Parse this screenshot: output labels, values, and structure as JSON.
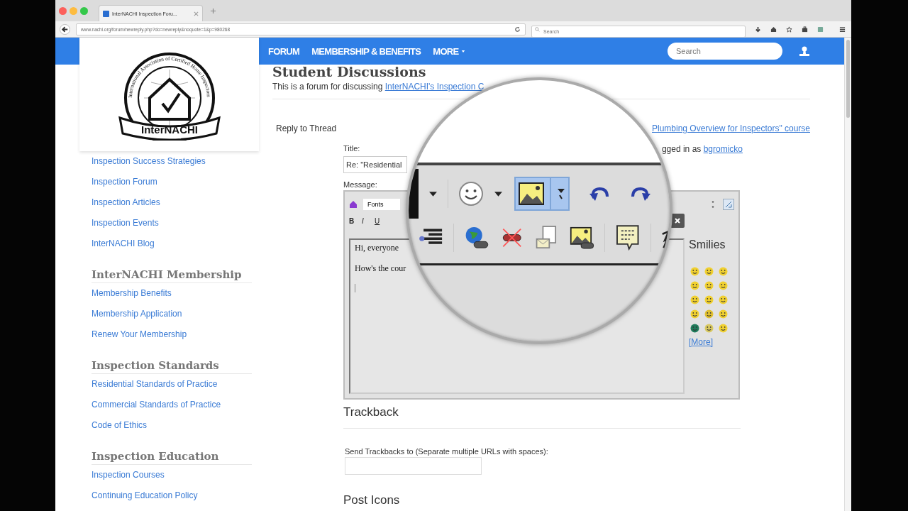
{
  "browser": {
    "tab_title": "InterNACHI Inspection Foru...",
    "url": "www.nachi.org/forum/newreply.php?do=newreply&noquote=1&p=980268",
    "search_placeholder": "Search"
  },
  "nav": {
    "items": [
      {
        "label": "FORUM",
        "dropdown": false
      },
      {
        "label": "MEMBERSHIP & BENEFITS",
        "dropdown": false
      },
      {
        "label": "MORE",
        "dropdown": true
      }
    ],
    "search_placeholder": "Search"
  },
  "logo": {
    "name": "InterNACHI",
    "ring_text": "International Association of Certified Home Inspectors"
  },
  "sidebar": {
    "links": [
      "Inspection Success Strategies",
      "Inspection Forum",
      "Inspection Articles",
      "Inspection Events",
      "InterNACHI Blog"
    ],
    "sections": [
      {
        "heading": "InterNACHI Membership",
        "links": [
          "Membership Benefits",
          "Membership Application",
          "Renew Your Membership"
        ]
      },
      {
        "heading": "Inspection Standards",
        "links": [
          "Residential Standards of Practice",
          "Commercial Standards of Practice",
          "Code of Ethics"
        ]
      },
      {
        "heading": "Inspection Education",
        "links": [
          "Inspection Courses",
          "Continuing Education Policy"
        ]
      }
    ]
  },
  "forum": {
    "title": "Student Discussions",
    "description": "This is a forum for discussing ",
    "description_link": "InterNACHI's Inspection C"
  },
  "reply": {
    "heading": "Reply to Thread",
    "course_link": "Plumbing Overview for Inspectors\" course",
    "logged_in": "gged in as ",
    "username": "bgromicko"
  },
  "title_field": {
    "label": "Title:",
    "value": "Re: \"Residential"
  },
  "message": {
    "label": "Message:",
    "font_select": "Fonts",
    "format_buttons": [
      "B",
      "I",
      "U"
    ],
    "lines": [
      "Hi, everyone",
      "How's the cour"
    ],
    "smilies_title": "Smilies",
    "more_link": "[More]",
    "smilies": [
      {
        "color": "#f0d030"
      },
      {
        "color": "#f0d030"
      },
      {
        "color": "#f0d030"
      },
      {
        "color": "#f0d030"
      },
      {
        "color": "#f0d030"
      },
      {
        "color": "#f0d030"
      },
      {
        "color": "#f0d030"
      },
      {
        "color": "#f0d030"
      },
      {
        "color": "#f0d030"
      },
      {
        "color": "#f0d030"
      },
      {
        "color": "#e0c030"
      },
      {
        "color": "#f0d030"
      },
      {
        "color": "#1f7a5a"
      },
      {
        "color": "#d8c860"
      },
      {
        "color": "#f0d030"
      }
    ]
  },
  "magnifier": {
    "image_button_selected": true
  },
  "trackback": {
    "heading": "Trackback",
    "label": "Send Trackbacks to (Separate multiple URLs with spaces):"
  },
  "post_icons": {
    "heading": "Post Icons"
  }
}
